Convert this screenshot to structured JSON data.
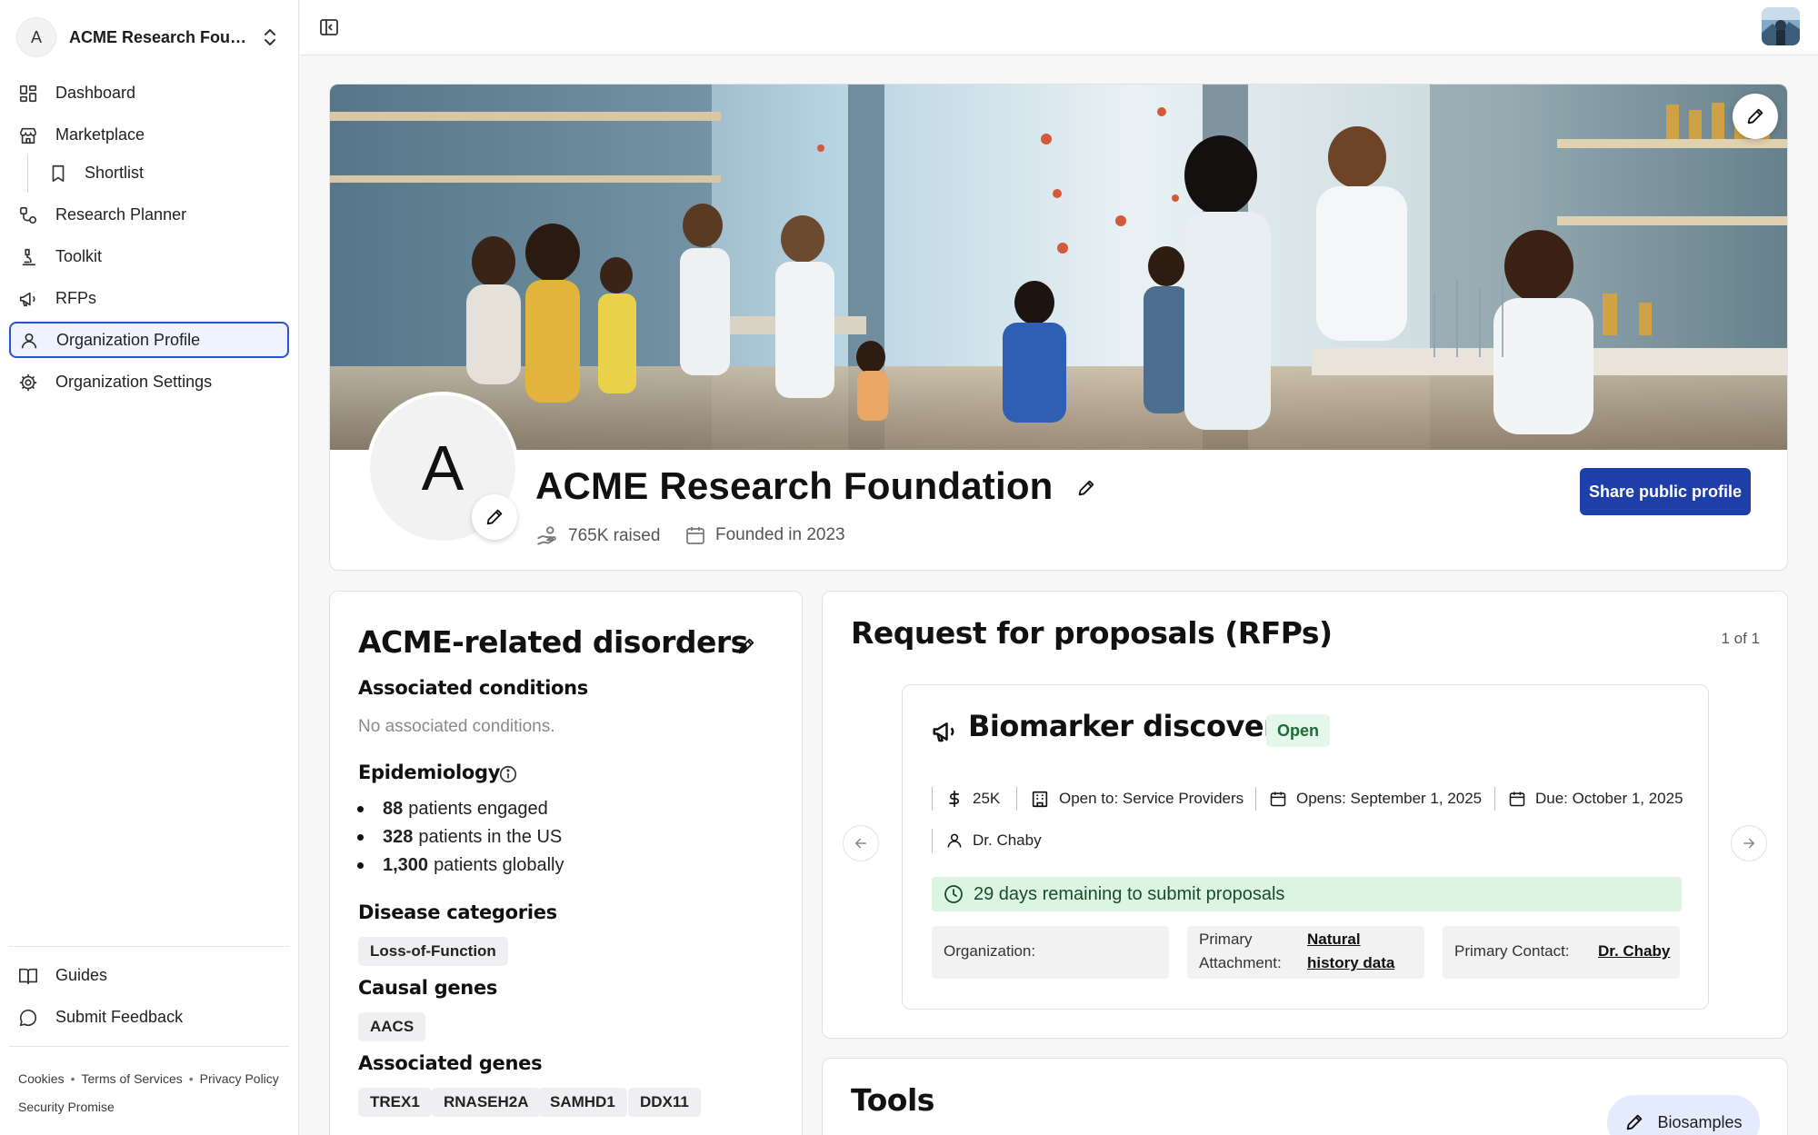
{
  "sidebar": {
    "org_initial": "A",
    "org_name": "ACME Research Founda...",
    "nav": [
      {
        "label": "Dashboard",
        "icon": "dashboard-icon"
      },
      {
        "label": "Marketplace",
        "icon": "store-icon"
      },
      {
        "label": "Shortlist",
        "icon": "bookmark-icon"
      },
      {
        "label": "Research Planner",
        "icon": "route-icon"
      },
      {
        "label": "Toolkit",
        "icon": "microscope-icon"
      },
      {
        "label": "RFPs",
        "icon": "megaphone-icon"
      },
      {
        "label": "Organization Profile",
        "icon": "user-icon",
        "active": true
      },
      {
        "label": "Organization Settings",
        "icon": "gear-icon"
      }
    ],
    "bottom_nav": [
      {
        "label": "Guides",
        "icon": "book-icon"
      },
      {
        "label": "Submit Feedback",
        "icon": "chat-bubble-icon"
      }
    ],
    "footer_links": [
      "Cookies",
      "Terms of Services",
      "Privacy Policy",
      "Security Promise"
    ]
  },
  "profile": {
    "logo_initial": "A",
    "name": "ACME Research Foundation",
    "raised": "765K raised",
    "founded": "Founded in 2023",
    "share_label": "Share public profile"
  },
  "disorders": {
    "title": "ACME-related disorders",
    "associated_conditions_heading": "Associated conditions",
    "associated_conditions_empty": "No associated conditions.",
    "epidemiology_heading": "Epidemiology",
    "epidemiology": [
      {
        "value": "88",
        "text": "patients engaged"
      },
      {
        "value": "328",
        "text": "patients in the US"
      },
      {
        "value": "1,300",
        "text": "patients globally"
      }
    ],
    "disease_categories_heading": "Disease categories",
    "disease_categories": [
      "Loss-of-Function"
    ],
    "causal_genes_heading": "Causal genes",
    "causal_genes": [
      "AACS"
    ],
    "associated_genes_heading": "Associated genes",
    "associated_genes": [
      "TREX1",
      "RNASEH2A",
      "SAMHD1",
      "DDX11"
    ]
  },
  "rfps": {
    "title": "Request for proposals (RFPs)",
    "pager": "1 of 1",
    "item": {
      "title": "Biomarker discovery",
      "status": "Open",
      "amount": "25K",
      "open_to": "Open to: Service Providers",
      "opens": "Opens: September 1, 2025",
      "due": "Due: October 1, 2025",
      "contact": "Dr. Chaby",
      "remaining": "29 days remaining to submit proposals",
      "organization_label": "Organization:",
      "organization_value": "",
      "primary_attachment_label_1": "Primary",
      "primary_attachment_label_2": "Attachment:",
      "primary_attachment_value_1": "Natural",
      "primary_attachment_value_2": "history data",
      "primary_contact_label": "Primary Contact:",
      "primary_contact_value": "Dr. Chaby"
    }
  },
  "tools": {
    "title": "Tools",
    "button": "Biosamples"
  },
  "colors": {
    "accent": "#1f3fa8",
    "active_nav_bg": "#eef3ff",
    "open_green": "#e5f6ea",
    "deadline_green": "#dcf5e2"
  }
}
